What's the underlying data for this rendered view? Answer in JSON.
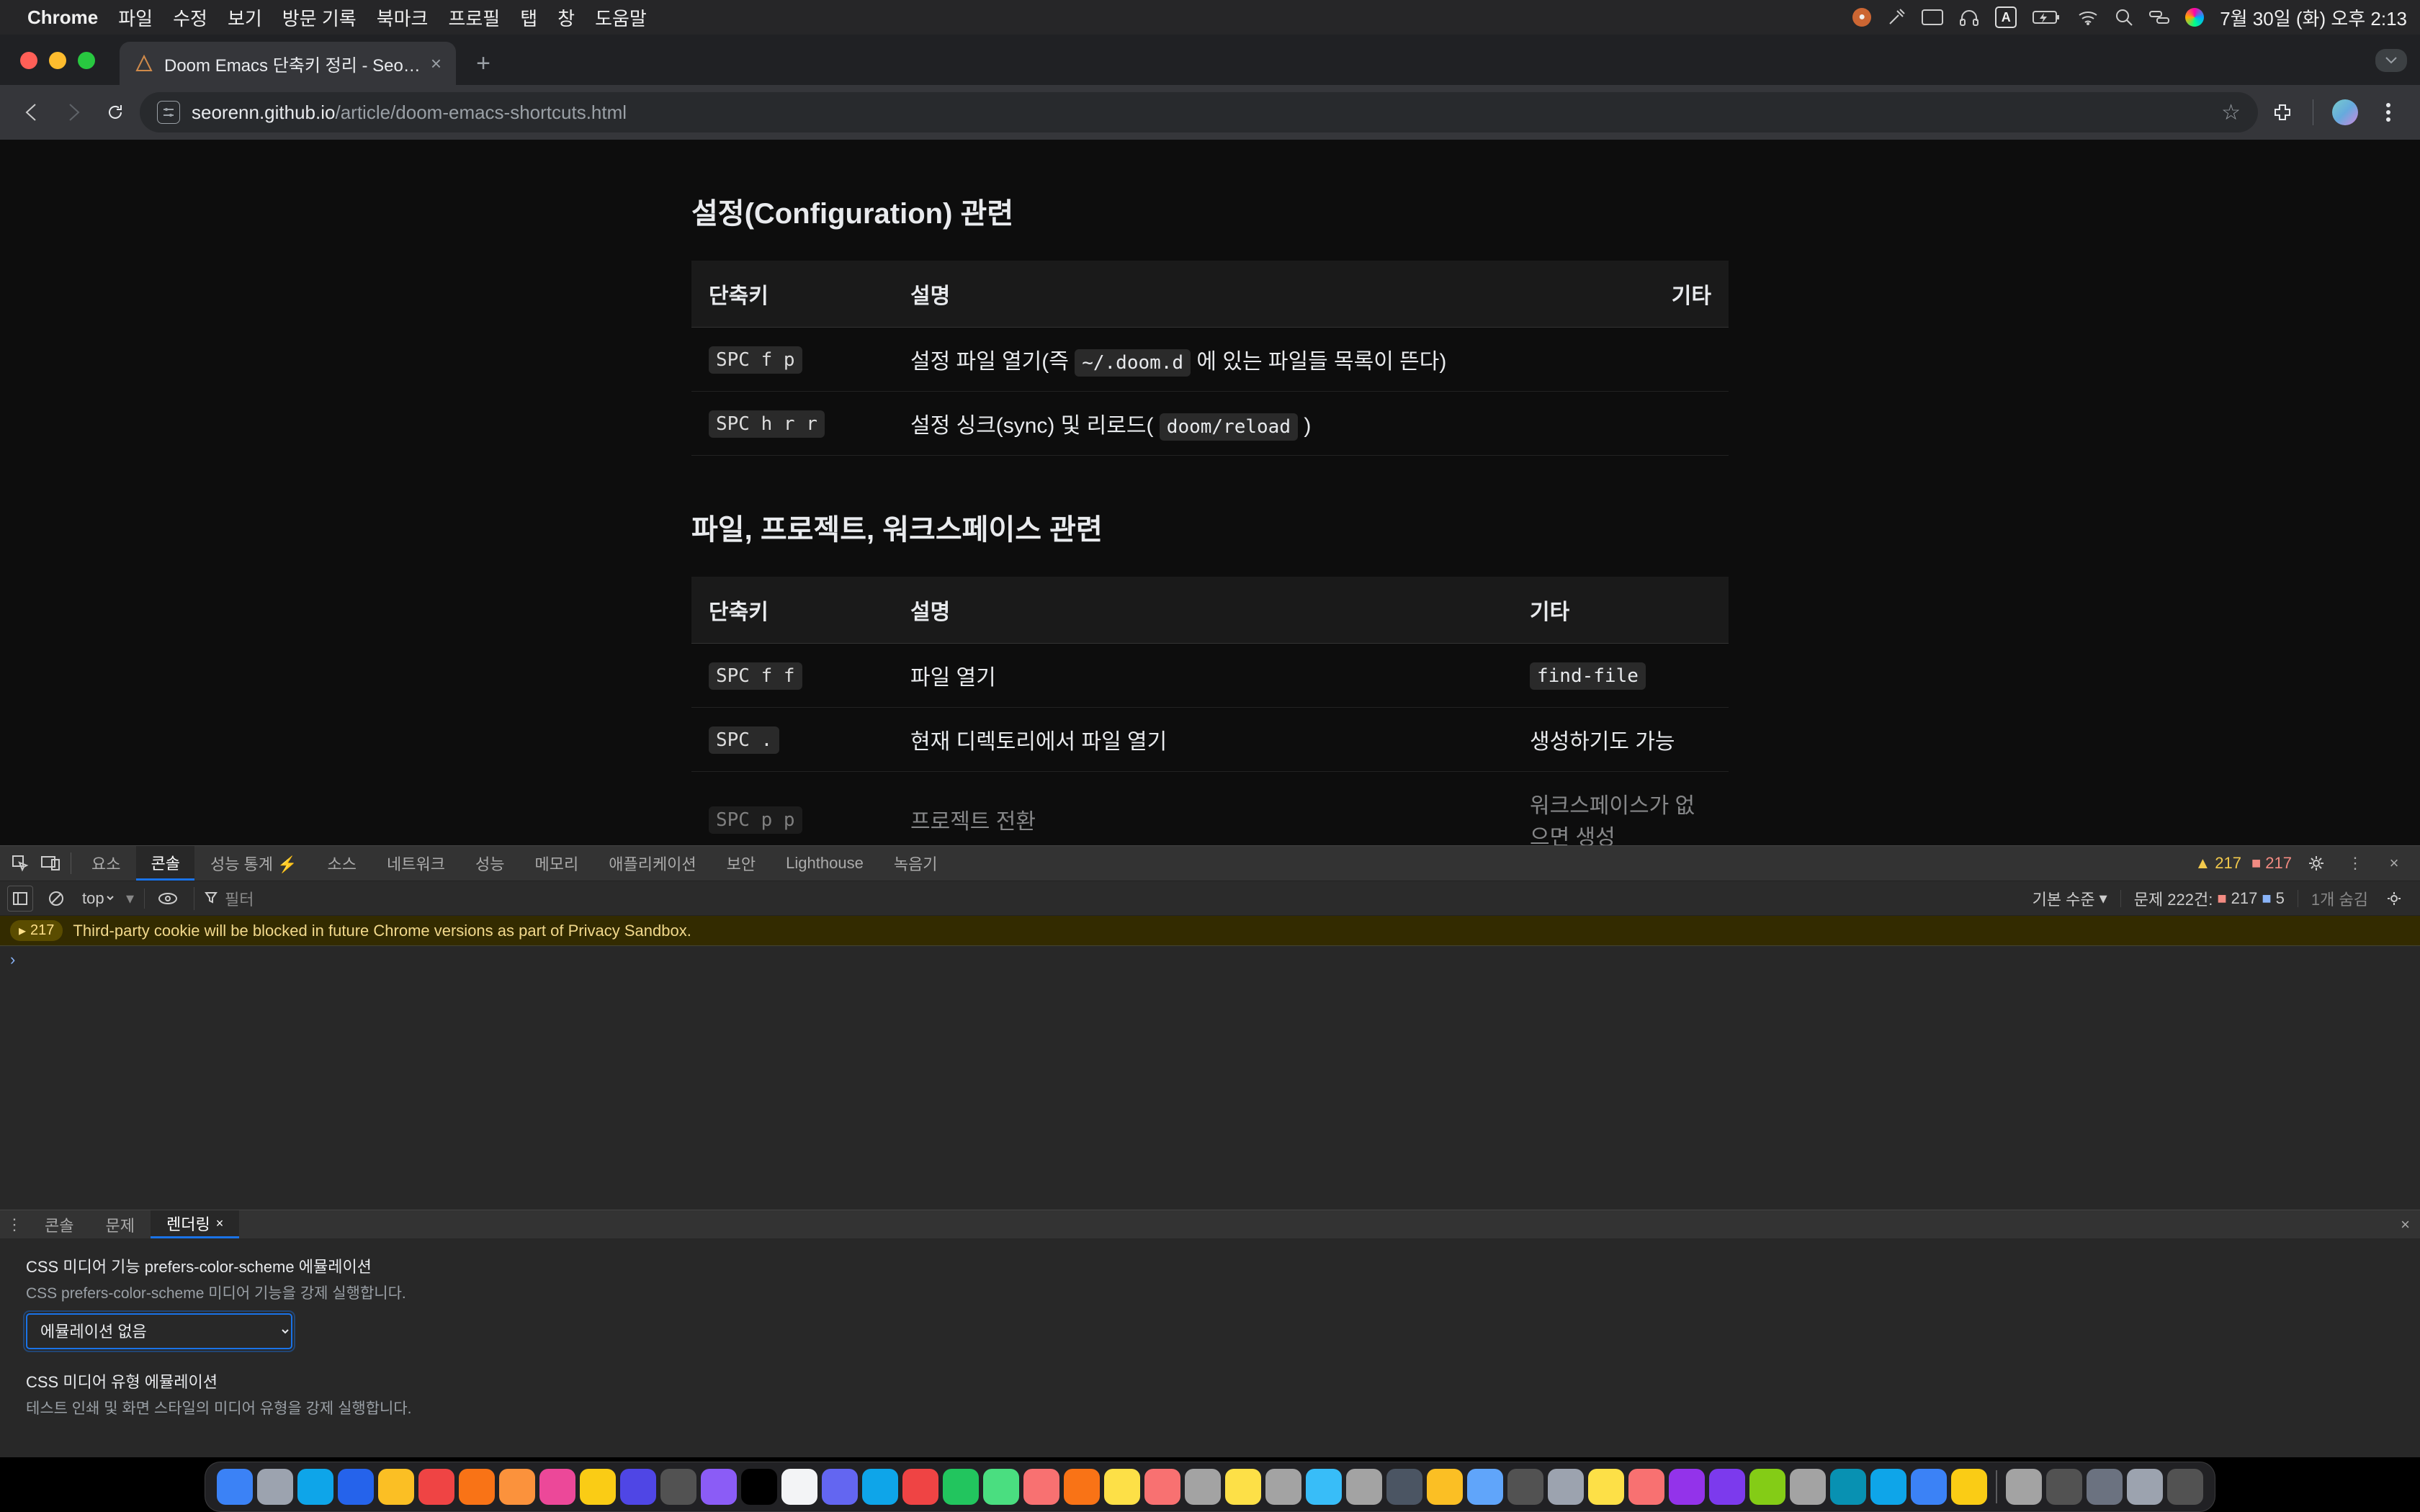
{
  "menubar": {
    "app": "Chrome",
    "items": [
      "파일",
      "수정",
      "보기",
      "방문 기록",
      "북마크",
      "프로필",
      "탭",
      "창",
      "도움말"
    ],
    "clock": "7월 30일 (화) 오후 2:13",
    "input_indicator": "A"
  },
  "tab": {
    "title": "Doom Emacs 단축키 정리 - Seo…"
  },
  "url": {
    "host": "seorenn.github.io",
    "path": "/article/doom-emacs-shortcuts.html"
  },
  "article": {
    "section1": {
      "heading": "설정(Configuration) 관련",
      "cols": [
        "단축키",
        "설명",
        "기타"
      ],
      "rows": [
        {
          "key": "SPC f p",
          "desc_pre": "설정 파일 열기(즉 ",
          "desc_code": "~/.doom.d",
          "desc_post": " 에 있는 파일들 목록이 뜬다)",
          "etc": ""
        },
        {
          "key": "SPC h r r",
          "desc_pre": "설정 싱크(sync) 및 리로드( ",
          "desc_code": "doom/reload",
          "desc_post": " )",
          "etc": ""
        }
      ]
    },
    "section2": {
      "heading": "파일, 프로젝트, 워크스페이스 관련",
      "cols": [
        "단축키",
        "설명",
        "기타"
      ],
      "rows": [
        {
          "key": "SPC f f",
          "desc": "파일 열기",
          "etc_code": "find-file"
        },
        {
          "key": "SPC .",
          "desc": "현재 디렉토리에서 파일 열기",
          "etc": "생성하기도 가능"
        },
        {
          "key": "SPC p p",
          "desc": "프로젝트 전환",
          "etc": "워크스페이스가 없으면 생성"
        }
      ]
    }
  },
  "devtools": {
    "tabs": [
      "요소",
      "콘솔",
      "성능 통계 ⚡",
      "소스",
      "네트워크",
      "성능",
      "메모리",
      "애플리케이션",
      "보안",
      "Lighthouse",
      "녹음기"
    ],
    "active_tab": "콘솔",
    "warn_count": "217",
    "err_count": "217",
    "context": "top",
    "filter_placeholder": "필터",
    "levels_label": "기본 수준",
    "issues_label": "문제 222건:",
    "issues_err": "217",
    "issues_info": "5",
    "hidden_label": "1개 숨김",
    "msg_badge": "217",
    "msg_text": "Third-party cookie will be blocked in future Chrome versions as part of Privacy Sandbox.",
    "drawer_tabs": [
      "콘솔",
      "문제",
      "렌더링"
    ],
    "drawer_active": "렌더링",
    "render": {
      "s1_title": "CSS 미디어 기능 prefers-color-scheme 에뮬레이션",
      "s1_desc": "CSS prefers-color-scheme 미디어 기능을 강제 실행합니다.",
      "s1_value": "에뮬레이션 없음",
      "s2_title": "CSS 미디어 유형 에뮬레이션",
      "s2_desc": "테스트 인쇄 및 화면 스타일의 미디어 유형을 강제 실행합니다."
    }
  },
  "dock_colors": [
    "#3b82f6",
    "#9ca3af",
    "#0ea5e9",
    "#2563eb",
    "#fbbf24",
    "#ef4444",
    "#f97316",
    "#fb923c",
    "#ec4899",
    "#facc15",
    "#4f46e5",
    "#525252",
    "#8b5cf6",
    "#000",
    "#f3f4f6",
    "#6366f1",
    "#0ea5e9",
    "#ef4444",
    "#22c55e",
    "#4ade80",
    "#f87171",
    "#f97316",
    "#fde047",
    "#f87171",
    "#a3a3a3",
    "#fde047",
    "#a3a3a3",
    "#38bdf8",
    "#a3a3a3",
    "#4b5563",
    "#fbbf24",
    "#60a5fa",
    "#525252",
    "#9ca3af",
    "#fde047",
    "#f87171",
    "#9333ea",
    "#7c3aed",
    "#84cc16",
    "#a3a3a3",
    "#0891b2",
    "#0ea5e9",
    "#3b82f6",
    "#facc15",
    "#a3a3a3",
    "#525252",
    "#6b7280",
    "#9ca3af",
    "#525252"
  ]
}
